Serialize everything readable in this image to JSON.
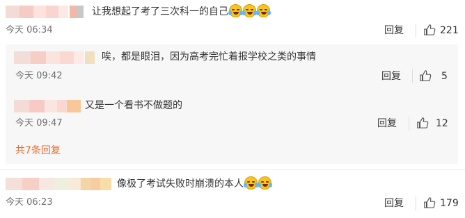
{
  "comments": [
    {
      "text": "让我想起了考了三次科一的自己",
      "emoji_count": 3,
      "time": "今天 06:34",
      "reply_label": "回复",
      "likes": "221"
    },
    {
      "text": "像极了考试失败时崩溃的本人",
      "emoji_count": 2,
      "time": "今天 06:23",
      "reply_label": "回复",
      "likes": "179"
    }
  ],
  "replies": [
    {
      "text": "唉，都是眼泪，因为高考完忙着报学校之类的事情",
      "time": "今天 09:42",
      "reply_label": "回复",
      "likes": "5"
    },
    {
      "text": "又是一个看书不做题的",
      "time": "今天 09:47",
      "reply_label": "回复",
      "likes": "12"
    }
  ],
  "expand_label": "共7条回复",
  "emoji_icon": "laughing-crying-face-icon",
  "like_icon": "thumbs-up-icon",
  "colors": {
    "accent": "#e86b2f",
    "nested_bg": "#f7f7f7",
    "text": "#333333",
    "muted": "#6f6f6f"
  }
}
